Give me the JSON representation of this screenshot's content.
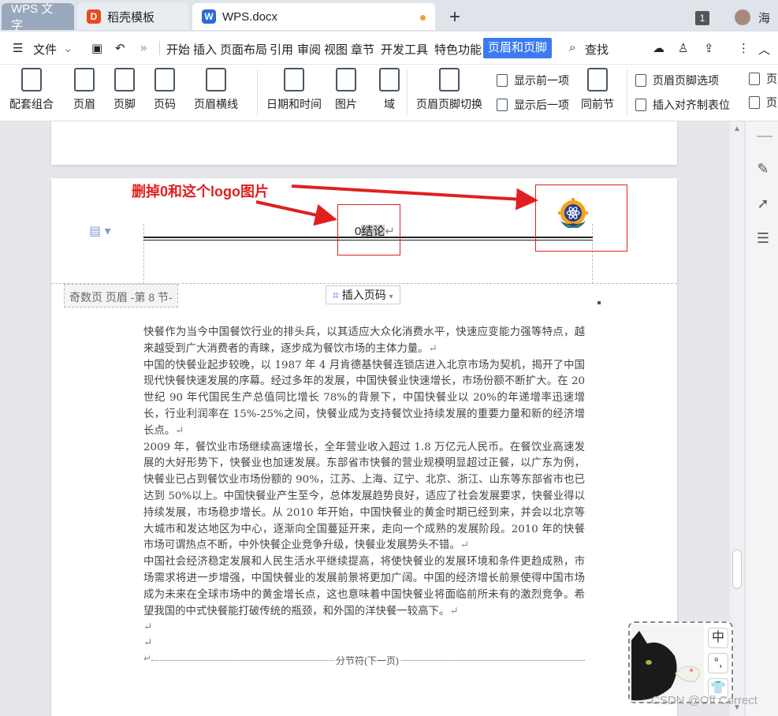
{
  "tabs": {
    "wps": "WPS 文字",
    "daoke": "稻壳模板",
    "doc": "WPS.docx",
    "plus": "+"
  },
  "window": {
    "badge": "1",
    "user": "海"
  },
  "menu": {
    "file": "文件",
    "items": [
      "开始",
      "插入",
      "页面布局",
      "引用",
      "审阅",
      "视图",
      "章节",
      "开发工具",
      "特色功能"
    ],
    "active": "页眉和页脚",
    "search": "查找"
  },
  "ribbon": {
    "peitao": "配套组合",
    "header": "页眉",
    "footer": "页脚",
    "pagenum": "页码",
    "header_line": "页眉横线",
    "datetime": "日期和时间",
    "picture": "图片",
    "field": "域",
    "switch": "页眉页脚切换",
    "show_prev": "显示前一项",
    "show_next": "显示后一项",
    "same_prev": "同前节",
    "hf_options": "页眉页脚选项",
    "insert_align": "插入对齐制表位",
    "more1": "页",
    "more2": "页"
  },
  "annotation": {
    "text": "删掉0和这个logo图片"
  },
  "header": {
    "zero": "0",
    "word": "结论",
    "label": "奇数页 页眉 -第 8 节-",
    "insert_page_num": "插入页码",
    "hidden_title": "结论"
  },
  "body": {
    "paragraphs": [
      "快餐作为当今中国餐饮行业的排头兵，以其适应大众化消费水平，快速应变能力强等特点，越来越受到广大消费者的青睐，逐步成为餐饮市场的主体力量。",
      "中国的快餐业起步较晚，以 1987 年 4 月肯德基快餐连锁店进入北京市场为契机，揭开了中国现代快餐快速发展的序幕。经过多年的发展，中国快餐业快速增长，市场份额不断扩大。在 20 世纪 90 年代国民生产总值同比增长 78%的背景下，中国快餐业以 20%的年递增率迅速增长，行业利润率在 15%-25%之间，快餐业成为支持餐饮业持续发展的重要力量和新的经济增长点。",
      "2009 年，餐饮业市场继续高速增长，全年营业收入超过 1.8 万亿元人民币。在餐饮业高速发展的大好形势下，快餐业也加速发展。东部省市快餐的营业规模明显超过正餐，以广东为例，快餐业已占到餐饮业市场份额的 90%，江苏、上海、辽宁、北京、浙江、山东等东部省市也已达到 50%以上。中国快餐业产生至今，总体发展趋势良好，适应了社会发展要求，快餐业得以持续发展，市场稳步增长。从 2010 年开始，中国快餐业的黄金时期已经到来，并会以北京等大城市和发达地区为中心，逐渐向全国蔓延开来，走向一个成熟的发展阶段。2010 年的快餐市场可谓热点不断，中外快餐企业竞争升级，快餐业发展势头不错。",
      "中国社会经济稳定发展和人民生活水平继续提高，将使快餐业的发展环境和条件更趋成熟，市场需求将进一步增强，中国快餐业的发展前景将更加广阔。中国的经济增长前景使得中国市场成为未来在全球市场中的黄金增长点，这也意味着中国快餐业将面临前所未有的激烈竞争。希望我国的中式快餐能打破传统的瓶颈，和外国的洋快餐一较高下。"
    ],
    "para_mark": "↵",
    "section_break": "分节符(下一页)"
  },
  "ime": {
    "lang": "中",
    "punct": "°,",
    "skin": "👕"
  },
  "watermark": "CSDN @Off Correct",
  "colors": {
    "accent": "#3c7af0",
    "annotation": "#e02020"
  }
}
